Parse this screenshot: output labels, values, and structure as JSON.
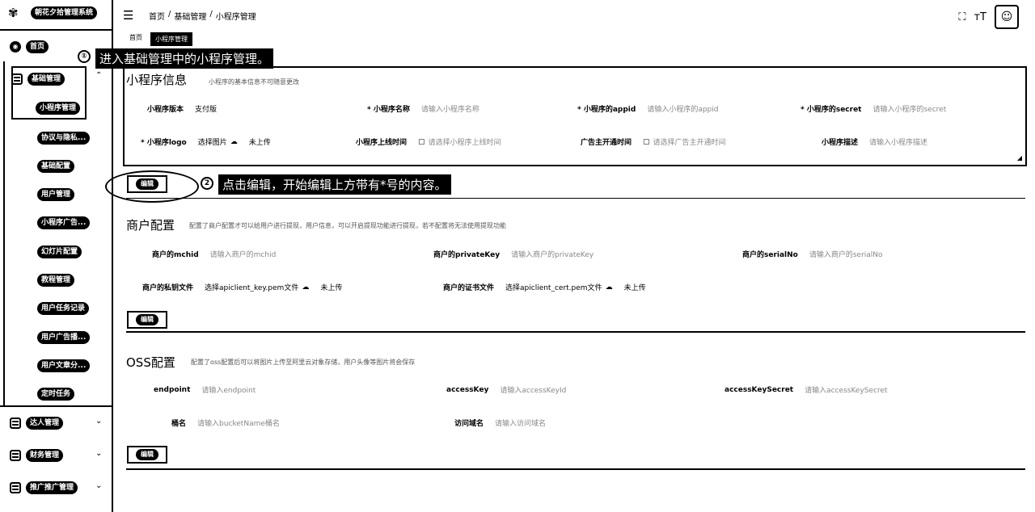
{
  "sidebar": {
    "logo_text": "朝花夕拾管理系统",
    "home": "首页",
    "group_basic": "基础管理",
    "items": [
      "小程序管理",
      "协议与隐私...",
      "基础配置",
      "用户管理",
      "小程序广告...",
      "幻灯片配置",
      "教程管理",
      "用户任务记录",
      "用户广告播...",
      "用户文章分...",
      "定时任务"
    ],
    "group_dar": "达人管理",
    "group_finance": "财务管理",
    "group_promo": "推广推广管理"
  },
  "topbar": {
    "breadcrumb": [
      "首页",
      "/",
      "基础管理",
      "/",
      "小程序管理"
    ],
    "fullscreen_icon": "fullscreen-icon",
    "font_icon": "font-size-icon"
  },
  "tabs": [
    "首页",
    "小程序管理"
  ],
  "annotations": {
    "step1_num": "①",
    "step1": "进入基础管理中的小程序管理。",
    "step2_num": "2",
    "step2": "点击编辑，开始编辑上方带有*号的内容。"
  },
  "miniapp": {
    "title": "小程序信息",
    "desc": "小程序的基本信息不可随意更改",
    "fields": [
      {
        "label": "小程序版本",
        "value": "支付版"
      },
      {
        "label": "* 小程序名称",
        "placeholder": "请输入小程序名称"
      },
      {
        "label": "* 小程序的appid",
        "placeholder": "请输入小程序的appid"
      },
      {
        "label": "* 小程序的secret",
        "placeholder": "请输入小程序的secret"
      },
      {
        "label": "* 小程序logo",
        "value": "选择图片",
        "status": "未上传"
      },
      {
        "label": "小程序上线时间",
        "placeholder": "请选择小程序上线时间"
      },
      {
        "label": "广告主开通时间",
        "placeholder": "请选择广告主开通时间"
      },
      {
        "label": "小程序描述",
        "placeholder": "请输入小程序描述"
      }
    ],
    "edit": "编辑"
  },
  "merchant": {
    "title": "商户配置",
    "desc": "配置了商户配置才可以给用户进行提现，用户信息，可以开启提现功能进行提现，若不配置将无法使用提现功能",
    "fields": [
      {
        "label": "商户的mchid",
        "placeholder": "请输入商户的mchid"
      },
      {
        "label": "商户的privateKey",
        "placeholder": "请输入商户的privateKey"
      },
      {
        "label": "商户的serialNo",
        "placeholder": "请输入商户的serialNo"
      },
      {
        "label": "商户的私钥文件",
        "value": "选择apiclient_key.pem文件",
        "status": "未上传"
      },
      {
        "label": "商户的证书文件",
        "value": "选择apiclient_cert.pem文件",
        "status": "未上传"
      }
    ],
    "edit": "编辑"
  },
  "oss": {
    "title": "OSS配置",
    "desc": "配置了oss配置后可以将图片上传至阿里云对象存储，用户头像等图片将会保存",
    "fields": [
      {
        "label": "endpoint",
        "placeholder": "请输入endpoint"
      },
      {
        "label": "accessKey",
        "placeholder": "请输入accessKeyId"
      },
      {
        "label": "accessKeySecret",
        "placeholder": "请输入accessKeySecret"
      },
      {
        "label": "桶名",
        "placeholder": "请输入bucketName桶名"
      },
      {
        "label": "访问域名",
        "placeholder": "请输入访问域名"
      }
    ],
    "edit": "编辑"
  }
}
